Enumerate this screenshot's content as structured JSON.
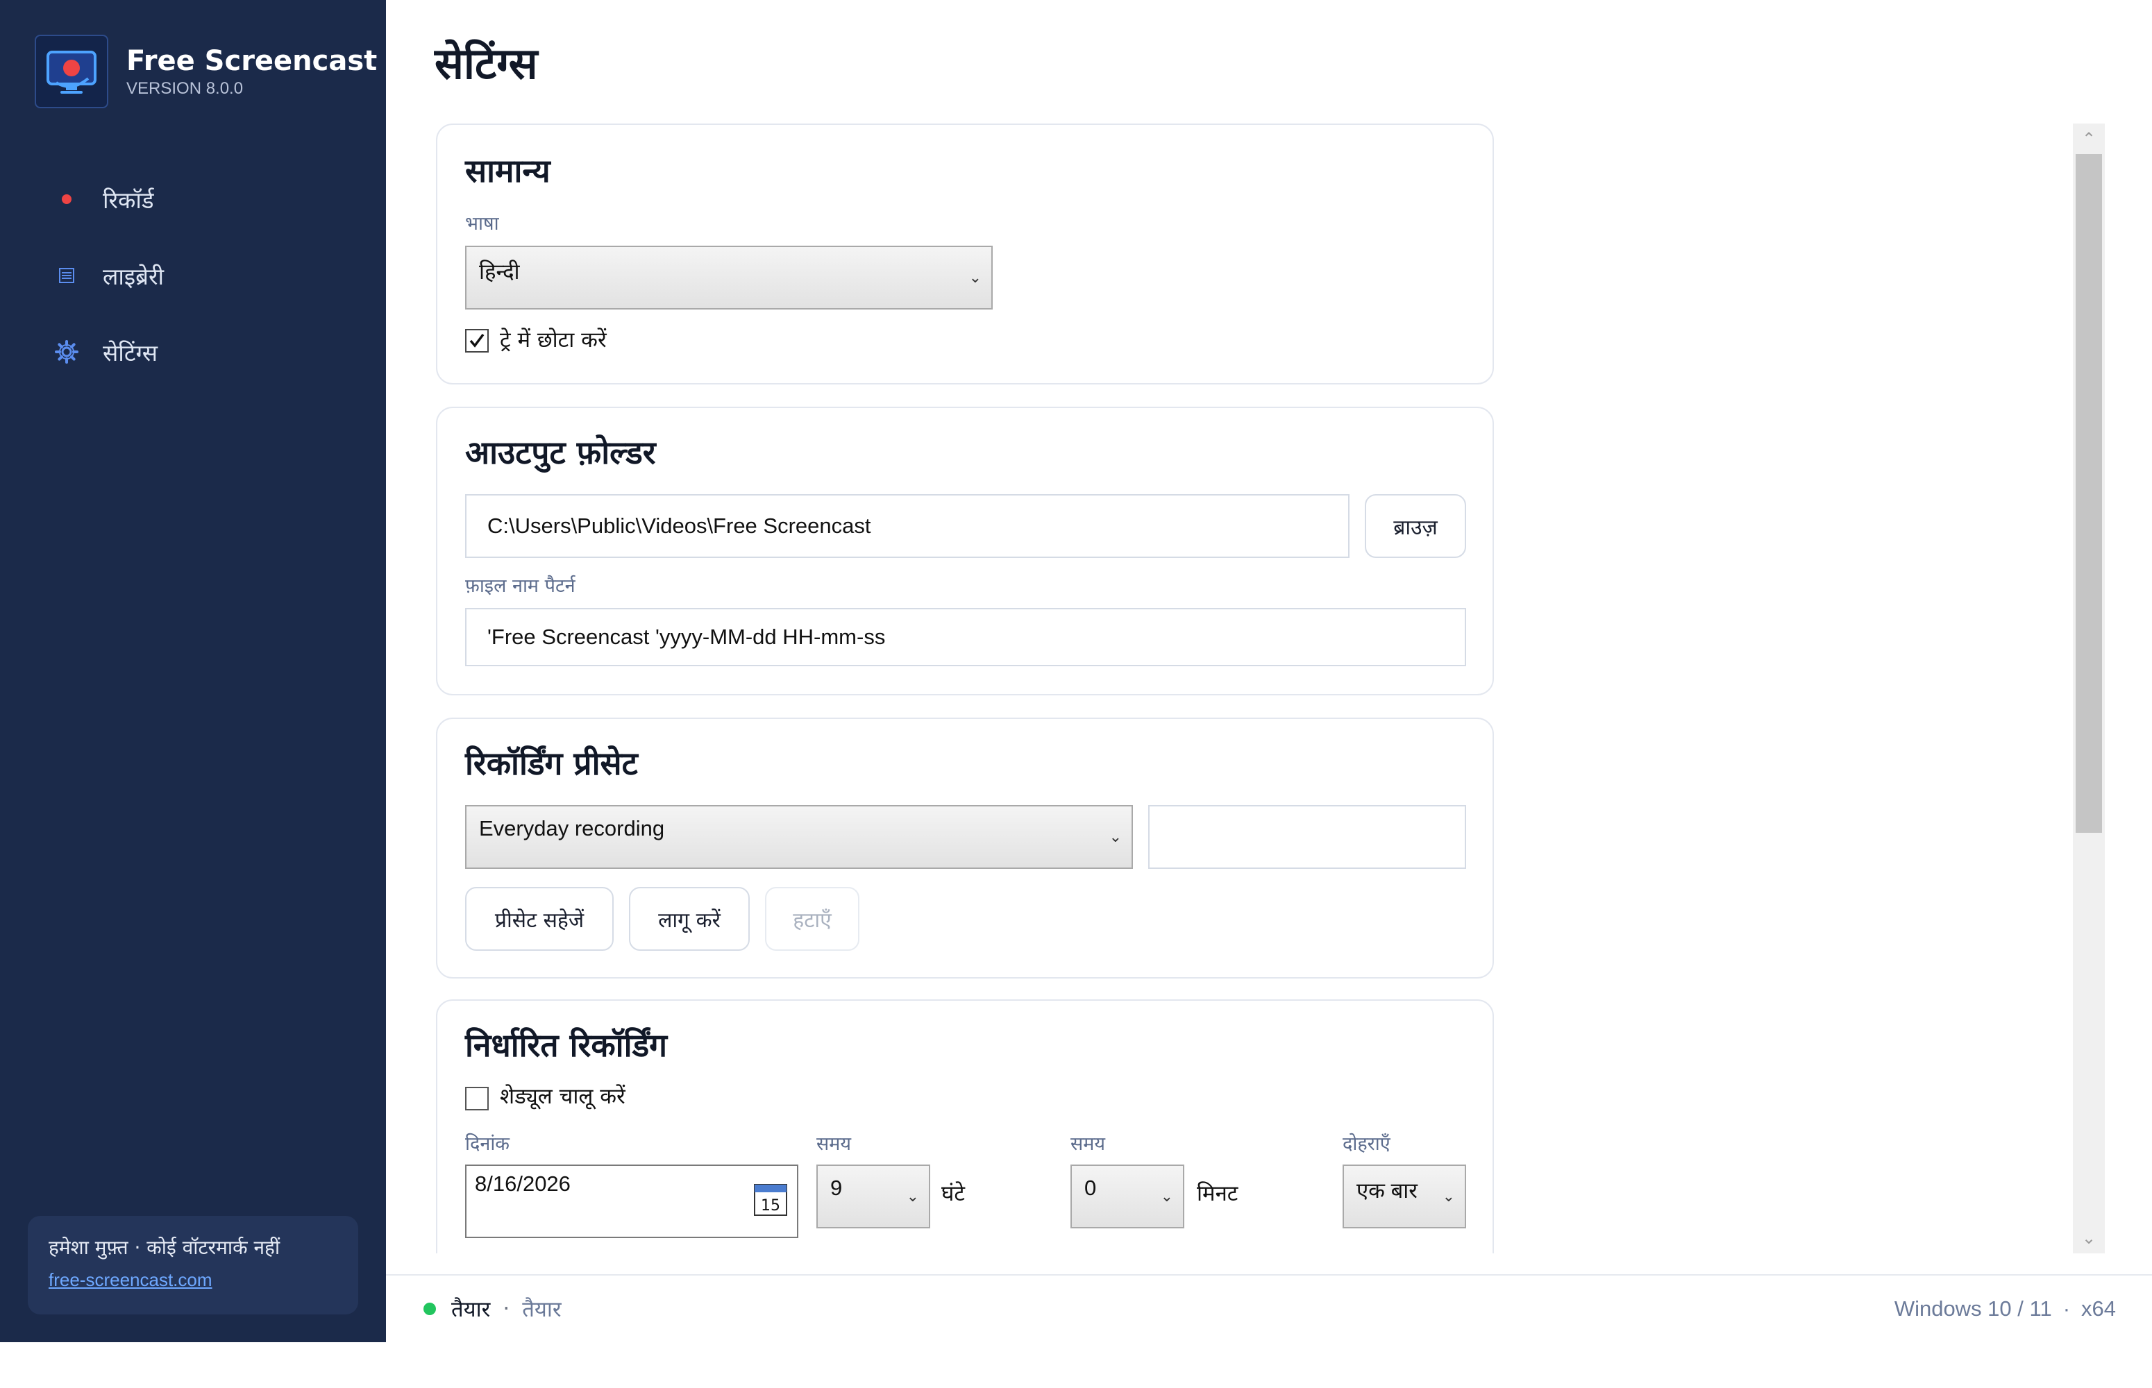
{
  "app": {
    "name": "Free Screencast",
    "version": "VERSION 8.0.0"
  },
  "nav": [
    {
      "label": "रिकॉर्ड",
      "icon": "record-dot-icon"
    },
    {
      "label": "लाइब्रेरी",
      "icon": "library-list-icon"
    },
    {
      "label": "सेटिंग्स",
      "icon": "gear-icon"
    }
  ],
  "promo": {
    "text": "हमेशा मुफ़्त · कोई वॉटरमार्क नहीं",
    "link": "free-screencast.com"
  },
  "page": {
    "title": "सेटिंग्स"
  },
  "general": {
    "title": "सामान्य",
    "language_label": "भाषा",
    "language_value": "हिन्दी",
    "tray_label": "ट्रे में छोटा करें",
    "tray_checked": true
  },
  "output": {
    "title": "आउटपुट फ़ोल्डर",
    "folder_value": "C:\\Users\\Public\\Videos\\Free Screencast",
    "browse_label": "ब्राउज़",
    "pattern_label": "फ़ाइल नाम पैटर्न",
    "pattern_value": "'Free Screencast 'yyyy-MM-dd HH-mm-ss"
  },
  "preset": {
    "title": "रिकॉर्डिंग प्रीसेट",
    "selected": "Everyday recording",
    "name_value": "",
    "save_label": "प्रीसेट सहेजें",
    "apply_label": "लागू करें",
    "delete_label": "हटाएँ"
  },
  "schedule": {
    "title": "निर्धारित रिकॉर्डिंग",
    "enable_label": "शेड्यूल चालू करें",
    "enable_checked": false,
    "date_label": "दिनांक",
    "date_value": "8/16/2026",
    "calendar_day": "15",
    "hour_label": "समय",
    "hour_value": "9",
    "hour_unit": "घंटे",
    "minute_label": "समय",
    "minute_value": "0",
    "minute_unit": "मिनट",
    "repeat_label": "दोहराएँ",
    "repeat_value": "एक बार"
  },
  "status": {
    "main": "तैयार",
    "separator": "·",
    "sub": "तैयार",
    "os": "Windows 10 / 11",
    "arch_separator": "·",
    "arch": "x64"
  },
  "colors": {
    "sidebar": "#1b2a4a",
    "record_dot": "#ef4444",
    "nav_icon": "#5b8def",
    "status_dot": "#22c55e",
    "link": "#6ea8ff"
  }
}
